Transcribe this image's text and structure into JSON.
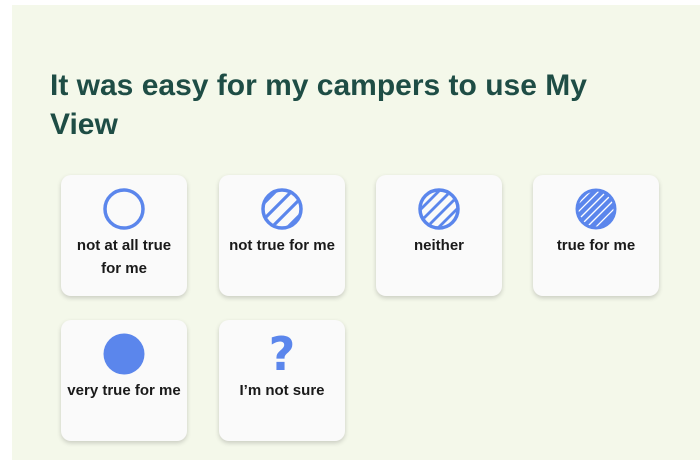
{
  "question": {
    "title": "It was easy for my campers to use My View"
  },
  "accent_color": "#5b86ec",
  "title_color": "#1e4d45",
  "options": [
    {
      "label": "not at all true for me",
      "icon": "empty-circle-icon"
    },
    {
      "label": "not true for me",
      "icon": "sparse-hatched-circle-icon"
    },
    {
      "label": "neither",
      "icon": "hatched-circle-icon"
    },
    {
      "label": "true for me",
      "icon": "dense-hatched-circle-icon"
    },
    {
      "label": "very true for me",
      "icon": "filled-circle-icon"
    },
    {
      "label": "I’m not sure",
      "icon": "question-mark-icon"
    }
  ]
}
